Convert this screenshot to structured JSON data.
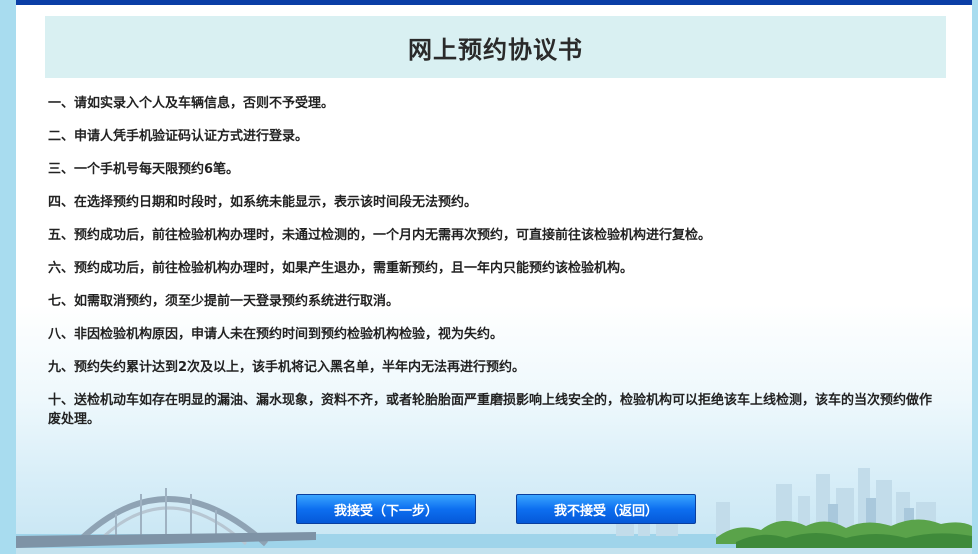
{
  "page": {
    "title": "网上预约协议书"
  },
  "clauses": [
    "一、请如实录入个人及车辆信息，否则不予受理。",
    "二、申请人凭手机验证码认证方式进行登录。",
    "三、一个手机号每天限预约6笔。",
    "四、在选择预约日期和时段时，如系统未能显示，表示该时间段无法预约。",
    "五、预约成功后，前往检验机构办理时，未通过检测的，一个月内无需再次预约，可直接前往该检验机构进行复检。",
    "六、预约成功后，前往检验机构办理时，如果产生退办，需重新预约，且一年内只能预约该检验机构。",
    "七、如需取消预约，须至少提前一天登录预约系统进行取消。",
    "八、非因检验机构原因，申请人未在预约时间到预约检验机构检验，视为失约。",
    "九、预约失约累计达到2次及以上，该手机将记入黑名单，半年内无法再进行预约。",
    "十、送检机动车如存在明显的漏油、漏水现象，资料不齐，或者轮胎胎面严重磨损影响上线安全的，检验机构可以拒绝该车上线检测，该车的当次预约做作废处理。"
  ],
  "buttons": {
    "accept_label": "我接受（下一步）",
    "reject_label": "我不接受（返回）"
  },
  "colors": {
    "top_bar": "#0b3ea6",
    "title_background": "#d9f0f2",
    "button_blue": "#0d6ff0",
    "side_background": "#a8dcef"
  }
}
